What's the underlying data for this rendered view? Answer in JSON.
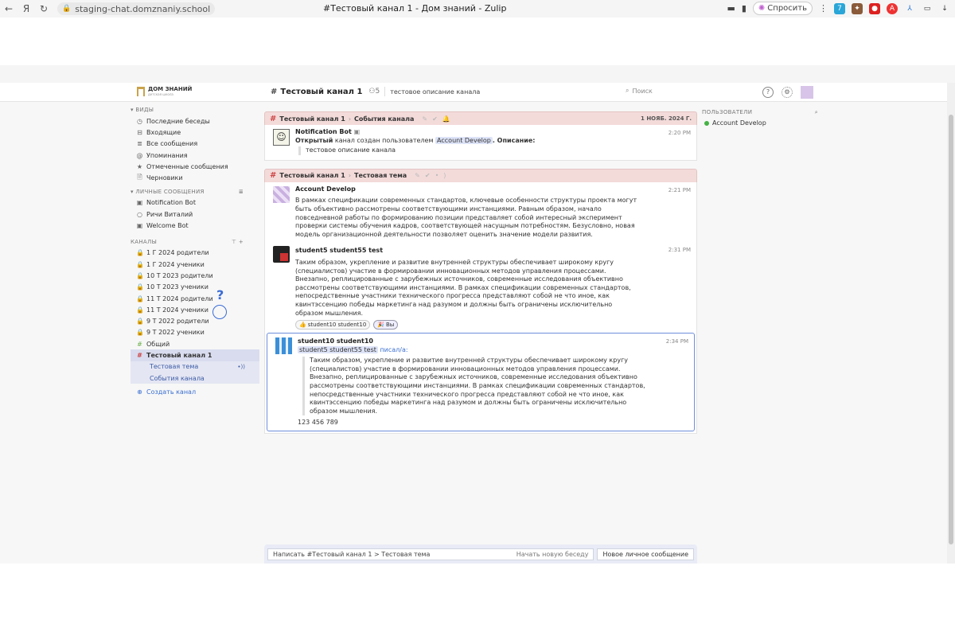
{
  "browser": {
    "url": "staging-chat.domznaniy.school",
    "tab_title": "#Тестовый канал 1 - Дом знаний - Zulip",
    "ask_label": "Спросить"
  },
  "topnav": {
    "logo_text": "ДОМ ЗНАНИЙ",
    "logo_sub": "детская школа",
    "stream_name": "Тестовый канал 1",
    "subscriber_count": "5",
    "stream_description": "тестовое описание канала",
    "search_placeholder": "Поиск"
  },
  "sidebar": {
    "views_header": "ВИДЫ",
    "views": [
      {
        "icon": "clock-icon",
        "glyph": "◷",
        "label": "Последние беседы"
      },
      {
        "icon": "inbox-icon",
        "glyph": "⊟",
        "label": "Входящие"
      },
      {
        "icon": "all-messages-icon",
        "glyph": "≣",
        "label": "Все сообщения"
      },
      {
        "icon": "at-icon",
        "glyph": "@",
        "label": "Упоминания"
      },
      {
        "icon": "star-icon",
        "glyph": "★",
        "label": "Отмеченные сообщения"
      },
      {
        "icon": "drafts-icon",
        "glyph": "🗎",
        "label": "Черновики"
      }
    ],
    "dm_header": "ЛИЧНЫЕ СООБЩЕНИЯ",
    "dms": [
      {
        "icon": "bot-icon",
        "glyph": "▣",
        "label": "Notification Bot"
      },
      {
        "icon": "user-offline-icon",
        "glyph": "○",
        "label": "Ричи Виталий"
      },
      {
        "icon": "bot-icon",
        "glyph": "▣",
        "label": "Welcome Bot"
      }
    ],
    "channels_header": "КАНАЛЫ",
    "channels": [
      {
        "label": "1 Г 2024 родители",
        "color": "#f0c24a",
        "glyph": "🔒"
      },
      {
        "label": "1 Г 2024 ученики",
        "color": "#f0c24a",
        "glyph": "🔒"
      },
      {
        "label": "10 Т 2023 родители",
        "color": "#e0a020",
        "glyph": "🔒"
      },
      {
        "label": "10 Т 2023 ученики",
        "color": "#c8c040",
        "glyph": "🔒"
      },
      {
        "label": "11 Т 2024 родители",
        "color": "#a08cd8",
        "glyph": "🔒"
      },
      {
        "label": "11 Т 2024 ученики",
        "color": "#c070c0",
        "glyph": "🔒"
      },
      {
        "label": "9 Т 2022 родители",
        "color": "#e07070",
        "glyph": "🔒"
      },
      {
        "label": "9 Т 2022 ученики",
        "color": "#f0d070",
        "glyph": "🔒"
      },
      {
        "label": "Общий",
        "color": "#6ab04c",
        "glyph": "#"
      }
    ],
    "active_channel": {
      "label": "Тестовый канал 1",
      "color": "#c44",
      "glyph": "#"
    },
    "topics": [
      "Тестовая тема",
      "События канала"
    ],
    "create_channel": "Создать канал"
  },
  "feed": {
    "groups": [
      {
        "stream": "Тестовый канал 1",
        "topic": "События канала",
        "date": "1 НОЯБ. 2024 Г.",
        "messages": [
          {
            "sender": "Notification Bot",
            "time": "2:20 PM",
            "lead_bold": "Открытый",
            "lead_text": " канал создан пользователем ",
            "mention": "Account Develop",
            "tail_bold": ". Описание:",
            "quote": "тестовое описание канала"
          }
        ]
      },
      {
        "stream": "Тестовый канал 1",
        "topic": "Тестовая тема",
        "messages": [
          {
            "sender": "Account Develop",
            "time": "2:21 PM",
            "text": "В рамках спецификации современных стандартов, ключевые особенности структуры проекта могут быть объективно рассмотрены соответствующими инстанциями. Равным образом, начало повседневной работы по формированию позиции представляет собой интересный эксперимент проверки системы обучения кадров, соответствующей насущным потребностям. Безусловно, новая модель организационной деятельности позволяет оценить значение модели развития."
          },
          {
            "sender": "student5 student55 test",
            "time": "2:31 PM",
            "text": "Таким образом, укрепление и развитие внутренней структуры обеспечивает широкому кругу (специалистов) участие в формировании инновационных методов управления процессами. Внезапно, реплицированные с зарубежных источников, современные исследования объективно рассмотрены соответствующими инстанциями. В рамках спецификации современных стандартов, непосредственные участники технического прогресса представляют собой не что иное, как квинтэссенцию победы маркетинга над разумом и должны быть ограничены исключительно образом мышления.",
            "reactions": [
              {
                "emoji": "👍",
                "label": "student10 student10"
              },
              {
                "emoji": "🎉",
                "label": "Вы"
              }
            ]
          },
          {
            "sender": "student10 student10",
            "time": "2:34 PM",
            "quoted_user": "student5 student55 test",
            "said_label": "писал/а:",
            "quote": "Таким образом, укрепление и развитие внутренней структуры обеспечивает широкому кругу (специалистов) участие в формировании инновационных методов управления процессами. Внезапно, реплицированные с зарубежных источников, современные исследования объективно рассмотрены соответствующими инстанциями. В рамках спецификации современных стандартов, непосредственные участники технического прогресса представляют собой не что иное, как квинтэссенцию победы маркетинга над разумом и должны быть ограничены исключительно образом мышления.",
            "text": "123 456 789"
          }
        ]
      }
    ]
  },
  "compose": {
    "placeholder": "Написать #Тестовый канал 1 > Тестовая тема",
    "new_conversation": "Начать новую беседу",
    "new_dm": "Новое личное сообщение"
  },
  "right": {
    "header": "ПОЛЬЗОВАТЕЛИ",
    "users": [
      {
        "name": "Account Develop",
        "status_color": "#44b244"
      }
    ]
  },
  "overlay": {
    "cursor_glyph": "?"
  }
}
